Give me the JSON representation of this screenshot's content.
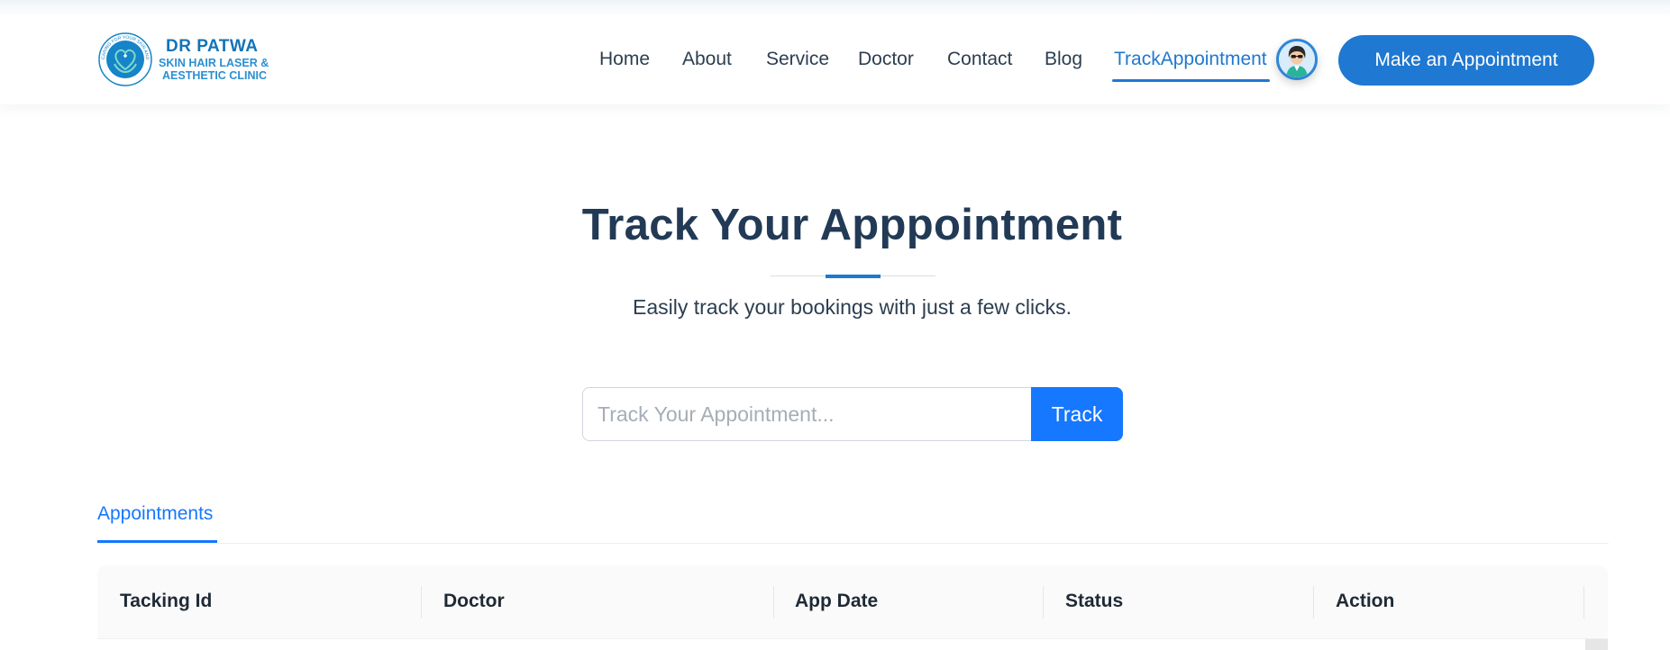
{
  "brand": {
    "line1": "DR PATWA",
    "line2": "SKIN HAIR LASER &",
    "line3": "AESTHETIC CLINIC",
    "ring_text": "CARING FOR YOUR SKIN AND HAIR",
    "color": "#1473b8"
  },
  "nav": {
    "items": [
      {
        "label": "Home",
        "active": false
      },
      {
        "label": "About",
        "active": false
      },
      {
        "label": "Service",
        "active": false
      },
      {
        "label": "Doctor",
        "active": false
      },
      {
        "label": "Contact",
        "active": false
      },
      {
        "label": "Blog",
        "active": false
      },
      {
        "label": "TrackAppointment",
        "active": true
      }
    ],
    "avatar_icon": "user-avatar-icon",
    "cta_label": "Make an Appointment",
    "accent_color": "#1f78d1"
  },
  "hero": {
    "title": "Track Your Apppointment",
    "subtitle": "Easily track your bookings with just a few clicks."
  },
  "search": {
    "placeholder": "Track Your Appointment...",
    "value": "",
    "button_label": "Track",
    "button_color": "#1677ff"
  },
  "tabs": {
    "items": [
      {
        "label": "Appointments",
        "active": true
      }
    ]
  },
  "table": {
    "columns": [
      "Tacking Id",
      "Doctor",
      "App Date",
      "Status",
      "Action"
    ],
    "rows": []
  }
}
